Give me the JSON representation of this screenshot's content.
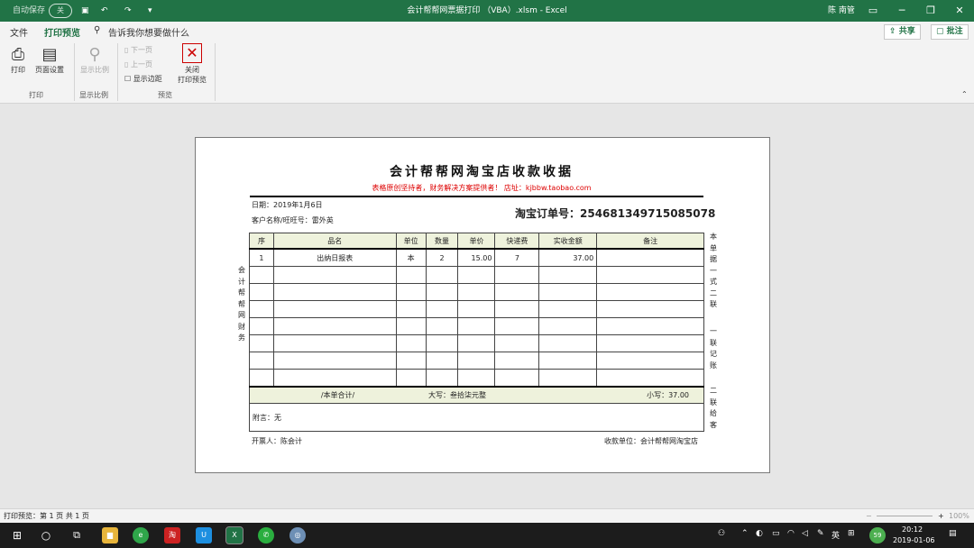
{
  "titlebar": {
    "autosave_label": "自动保存",
    "autosave_state": "关",
    "title": "会计帮帮网票据打印 （VBA）.xlsm - Excel",
    "user": "陈 南管"
  },
  "ribbon": {
    "tabs": [
      "文件",
      "打印预览"
    ],
    "tell_me": "告诉我你想要做什么",
    "share": "共享",
    "comments": "批注",
    "buttons": {
      "print": "打印",
      "page_setup": "页面设置",
      "zoom": "显示比例",
      "next_page": "下一页",
      "prev_page": "上一页",
      "show_margins": "显示边距",
      "close_preview_1": "关闭",
      "close_preview_2": "打印预览"
    },
    "groups": {
      "print": "打印",
      "zoom": "显示比例",
      "preview": "预览"
    }
  },
  "receipt": {
    "title": "会计帮帮网淘宝店收款收据",
    "subtitle": "表格原创坚持者，财务解决方案提供者！ 店址：kjbbw.taobao.com",
    "date": "日期：2019年1月6日",
    "customer": "客户名称/旺旺号：雷外英",
    "order": "淘宝订单号：254681349715085078",
    "columns": [
      "序",
      "品名",
      "单位",
      "数量",
      "单价",
      "快递费",
      "实收金额",
      "备注"
    ],
    "rows": [
      [
        "1",
        "出纳日报表",
        "本",
        "2",
        "15.00",
        "7",
        "37.00",
        ""
      ]
    ],
    "empty_rows": 7,
    "subtotal_label": "/本单合计/",
    "capital_label": "大写：叁拾柒元整",
    "small_label": "小写：37.00",
    "note": "附言：无",
    "issuer": "开票人：陈会计",
    "payee": "收款单位：会计帮帮网淘宝店",
    "side_left": "会计帮帮网财务",
    "side_right_1": "本单据一式二联",
    "side_right_2": "一联记账",
    "side_right_3": "二联给客"
  },
  "status": {
    "left": "打印预览：第 1 页 共 1 页",
    "zoom": "100%"
  },
  "taskbar": {
    "apps": [
      "文件资源管理器",
      "360浏览器",
      "淘宝",
      "钉钉",
      "Excel",
      "微信",
      "网络"
    ],
    "ime": "英",
    "badge": "59",
    "time": "20:12",
    "date": "2019-01-06"
  },
  "colors": {
    "excel_green": "#217346",
    "table_header": "#eef2dc",
    "subtitle_red": "#dd0000"
  }
}
